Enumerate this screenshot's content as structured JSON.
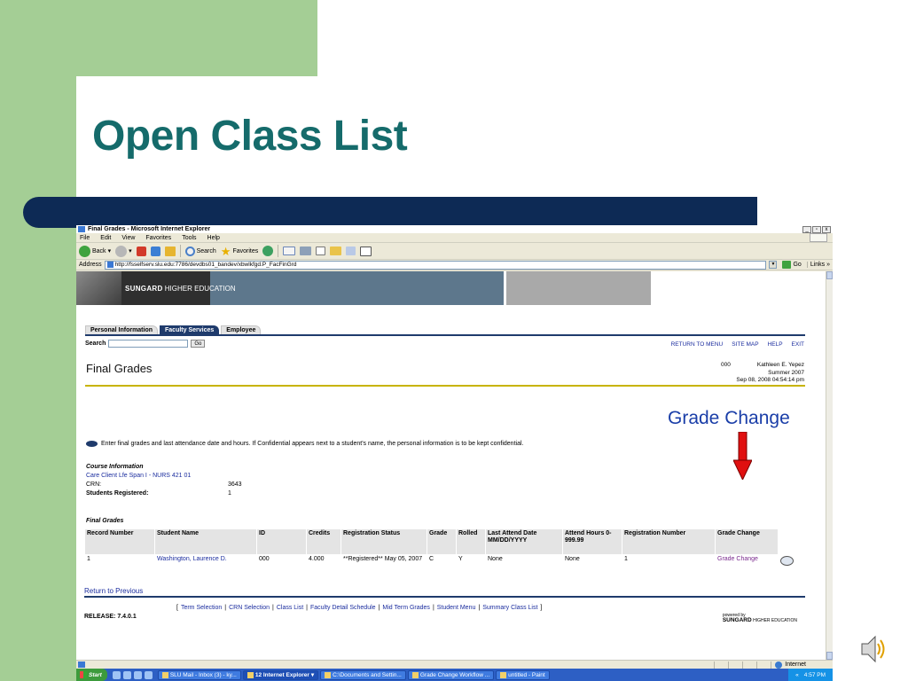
{
  "slide": {
    "title": "Open Class List",
    "annotation": "Grade Change"
  },
  "window": {
    "title": "Final Grades - Microsoft Internet Explorer",
    "controls": [
      "_",
      "▫",
      "x"
    ]
  },
  "menubar": [
    "File",
    "Edit",
    "View",
    "Favorites",
    "Tools",
    "Help"
  ],
  "toolbar": {
    "back": "Back",
    "search": "Search",
    "favorites": "Favorites"
  },
  "addressbar": {
    "label": "Address",
    "url": "http://fsselfserv.slu.edu:7786/devdbs01_bandev/xbwlkfgd.P_FacFinGrd",
    "go": "Go",
    "links": "Links"
  },
  "banner": {
    "brand_bold": "SUNGARD",
    "brand_rest": "HIGHER EDUCATION"
  },
  "tabs": [
    "Personal Information",
    "Faculty Services",
    "Employee"
  ],
  "search": {
    "label": "Search",
    "go": "Go"
  },
  "top_links": [
    "RETURN TO MENU",
    "SITE MAP",
    "HELP",
    "EXIT"
  ],
  "page": {
    "heading": "Final Grades",
    "id": "000",
    "user": "Kathleen E. Yepez",
    "term": "Summer 2007",
    "datetime": "Sep 08, 2008 04:54:14 pm",
    "info": "Enter final grades and last attendance date and hours. If Confidential appears next to a student's name, the personal information is to be kept confidential."
  },
  "course": {
    "section_title": "Course Information",
    "course_link": "Care Client Lfe Span I - NURS 421 01",
    "crn_label": "CRN:",
    "crn_value": "3643",
    "students_label": "Students Registered:",
    "students_value": "1"
  },
  "grades": {
    "section_title": "Final Grades",
    "headers": {
      "record": "Record Number",
      "student": "Student Name",
      "id": "ID",
      "credits": "Credits",
      "reg_status": "Registration Status",
      "grade": "Grade",
      "rolled": "Rolled",
      "last_attend": "Last Attend Date MM/DD/YYYY",
      "attend_hours": "Attend Hours 0-999.99",
      "reg_number": "Registration Number",
      "grade_change": "Grade Change"
    },
    "rows": [
      {
        "record": "1",
        "student": "Washington, Laurence D.",
        "id": "000",
        "credits": "4.000",
        "reg_status": "**Registered** May 05, 2007",
        "grade": "C",
        "rolled": "Y",
        "last_attend": "None",
        "attend_hours": "None",
        "reg_number": "1",
        "grade_change": "Grade Change"
      }
    ]
  },
  "footer": {
    "return_link": "Return to Previous",
    "links": [
      "Term Selection",
      "CRN Selection",
      "Class List",
      "Faculty Detail Schedule",
      "Mid Term Grades",
      "Student Menu",
      "Summary Class List"
    ],
    "release": "RELEASE: 7.4.0.1",
    "powered_small": "powered by",
    "powered_brand": "SUNGARD",
    "powered_rest": "HIGHER EDUCATION"
  },
  "statusbar": {
    "zone": "Internet"
  },
  "taskbar": {
    "start": "Start",
    "tasks": [
      "SLU Mail - Inbox (3) - ky...",
      "12 Internet Explorer",
      "C:\\Documents and Settin...",
      "Grade Change Workflow ...",
      "untitled - Paint"
    ],
    "clock": "4:57 PM",
    "tray_arrows": "«"
  },
  "colors": {
    "slide_green": "#a4ce95",
    "title_teal": "#156b6b",
    "navy_bar": "#0d2a55",
    "annotation_blue": "#1a3ea8",
    "arrow_red": "#e01010"
  }
}
